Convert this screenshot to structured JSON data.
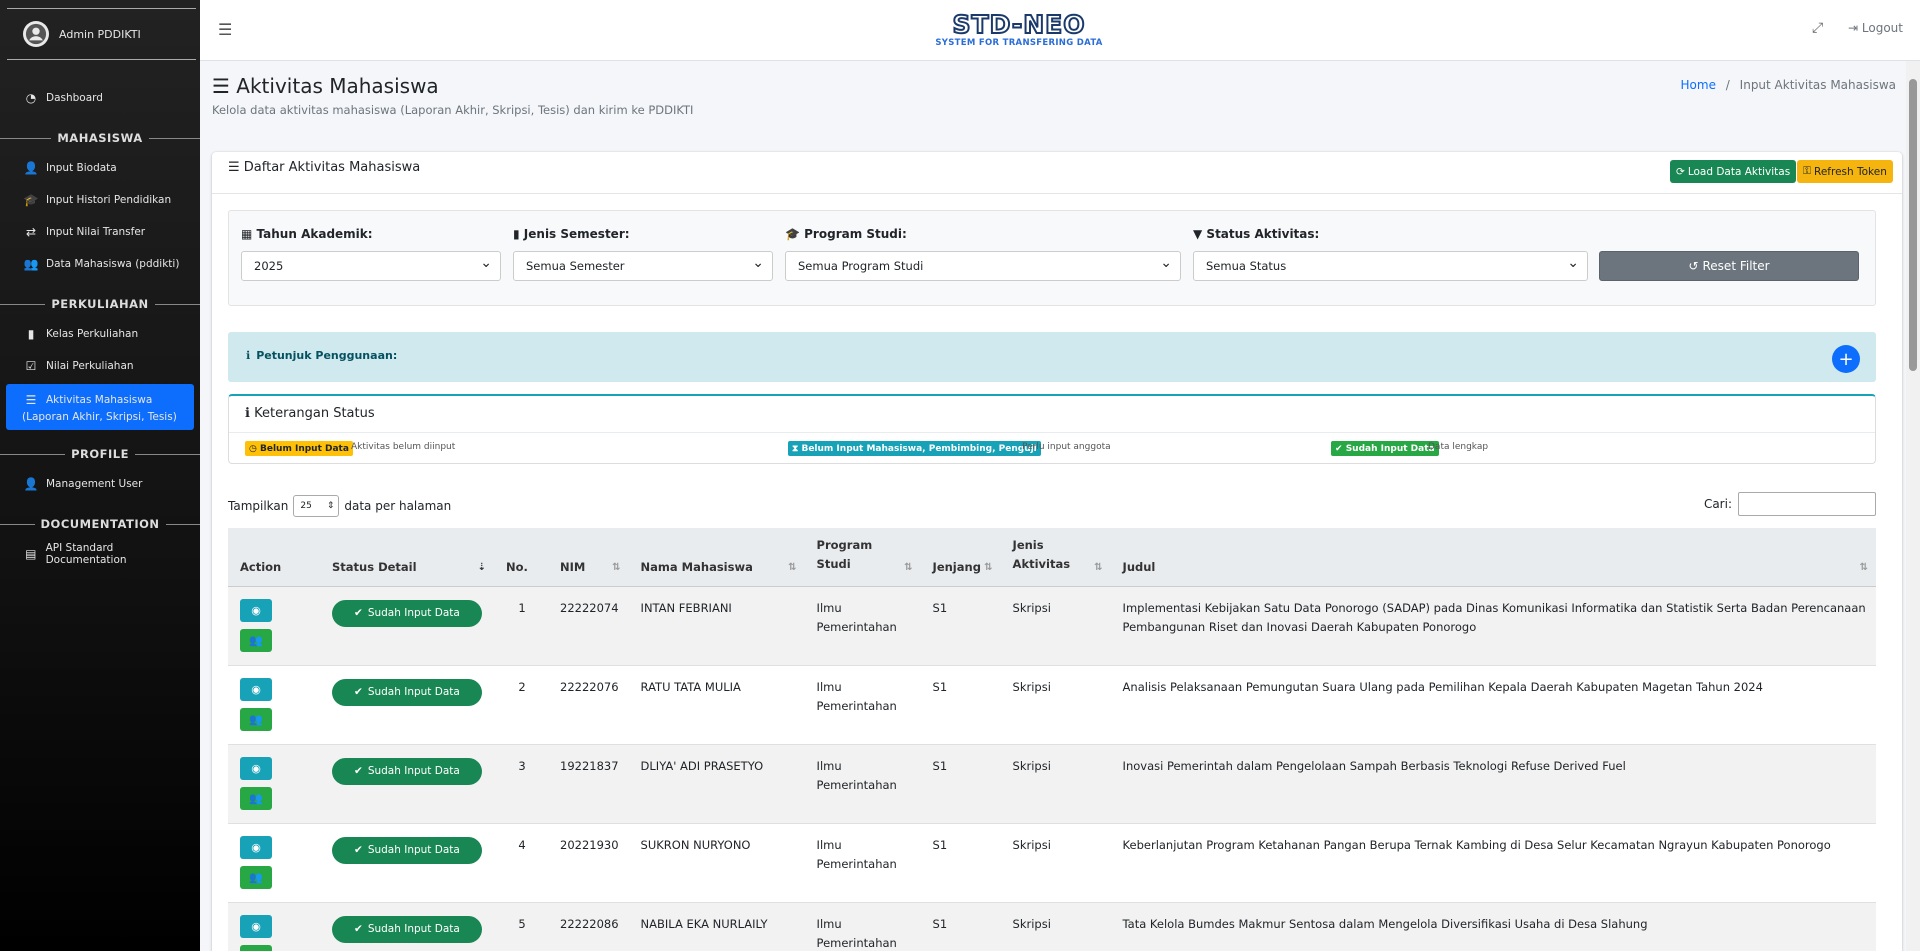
{
  "sidebar": {
    "user": "Admin PDDIKTI",
    "dashboard": "Dashboard",
    "sections": {
      "mahasiswa": "MAHASISWA",
      "perkuliahan": "PERKULIAHAN",
      "profile": "PROFILE",
      "documentation": "DOCUMENTATION"
    },
    "items": {
      "input_biodata": "Input Biodata",
      "input_histori": "Input Histori Pendidikan",
      "input_nilai_transfer": "Input Nilai Transfer",
      "data_mahasiswa": "Data Mahasiswa (pddikti)",
      "kelas_perkuliahan": "Kelas Perkuliahan",
      "nilai_perkuliahan": "Nilai Perkuliahan",
      "aktivitas_line1": "Aktivitas Mahasiswa",
      "aktivitas_line2": "(Laporan Akhir, Skripsi, Tesis)",
      "management_user": "Management User",
      "api_doc": "API Standard Documentation"
    }
  },
  "topnav": {
    "logo_main": "STD-NEO",
    "logo_sub": "SYSTEM FOR TRANSFERING DATA",
    "logout": "Logout"
  },
  "header": {
    "title": "Aktivitas Mahasiswa",
    "subtitle": "Kelola data aktivitas mahasiswa (Laporan Akhir, Skripsi, Tesis) dan kirim ke PDDIKTI",
    "breadcrumb_home": "Home",
    "breadcrumb_current": "Input Aktivitas Mahasiswa"
  },
  "card": {
    "title": "Daftar Aktivitas Mahasiswa",
    "load_btn": "Load Data Aktivitas",
    "refresh_btn": "Refresh Token"
  },
  "filters": {
    "tahun_label": "Tahun Akademik:",
    "tahun_value": "2025",
    "semester_label": "Jenis Semester:",
    "semester_value": "Semua Semester",
    "prodi_label": "Program Studi:",
    "prodi_value": "Semua Program Studi",
    "status_label": "Status Aktivitas:",
    "status_value": "Semua Status",
    "reset": "Reset Filter"
  },
  "petunjuk": "Petunjuk Penggunaan:",
  "keterangan": {
    "title": "Keterangan Status",
    "belum": "Belum Input Data",
    "belum_desc": "Aktivitas belum diinput",
    "partial": "Belum Input Mahasiswa, Pembimbing, Penguji",
    "partial_desc": "Perlu input anggota",
    "sudah": "Sudah Input Data",
    "sudah_desc": "Data lengkap"
  },
  "table_controls": {
    "show_prefix": "Tampilkan",
    "page_len": "25",
    "show_suffix": "data per halaman",
    "search_label": "Cari:"
  },
  "table": {
    "headers": {
      "action": "Action",
      "status": "Status Detail",
      "no": "No.",
      "nim": "NIM",
      "nama": "Nama Mahasiswa",
      "prodi": "Program Studi",
      "jenjang": "Jenjang",
      "jenis": "Jenis Aktivitas",
      "judul": "Judul"
    },
    "rows": [
      {
        "status": "Sudah Input Data",
        "no": "1",
        "nim": "22222074",
        "nama": "INTAN FEBRIANI",
        "prodi": "Ilmu Pemerintahan",
        "jenjang": "S1",
        "jenis": "Skripsi",
        "judul": "Implementasi Kebijakan Satu Data Ponorogo (SADAP) pada Dinas Komunikasi Informatika dan Statistik Serta Badan Perencanaan Pembangunan Riset dan Inovasi Daerah Kabupaten Ponorogo"
      },
      {
        "status": "Sudah Input Data",
        "no": "2",
        "nim": "22222076",
        "nama": "RATU TATA MULIA",
        "prodi": "Ilmu Pemerintahan",
        "jenjang": "S1",
        "jenis": "Skripsi",
        "judul": "Analisis Pelaksanaan Pemungutan Suara Ulang pada Pemilihan Kepala Daerah Kabupaten Magetan Tahun 2024"
      },
      {
        "status": "Sudah Input Data",
        "no": "3",
        "nim": "19221837",
        "nama": "DLIYA' ADI PRASETYO",
        "prodi": "Ilmu Pemerintahan",
        "jenjang": "S1",
        "jenis": "Skripsi",
        "judul": "Inovasi Pemerintah dalam Pengelolaan Sampah Berbasis Teknologi Refuse Derived Fuel"
      },
      {
        "status": "Sudah Input Data",
        "no": "4",
        "nim": "20221930",
        "nama": "SUKRON NURYONO",
        "prodi": "Ilmu Pemerintahan",
        "jenjang": "S1",
        "jenis": "Skripsi",
        "judul": "Keberlanjutan Program Ketahanan Pangan Berupa Ternak Kambing di Desa Selur Kecamatan Ngrayun Kabupaten Ponorogo"
      },
      {
        "status": "Sudah Input Data",
        "no": "5",
        "nim": "22222086",
        "nama": "NABILA EKA NURLAILY",
        "prodi": "Ilmu Pemerintahan",
        "jenjang": "S1",
        "jenis": "Skripsi",
        "judul": "Tata Kelola Bumdes Makmur Sentosa dalam Mengelola Diversifikasi Usaha di Desa Slahung"
      }
    ]
  }
}
